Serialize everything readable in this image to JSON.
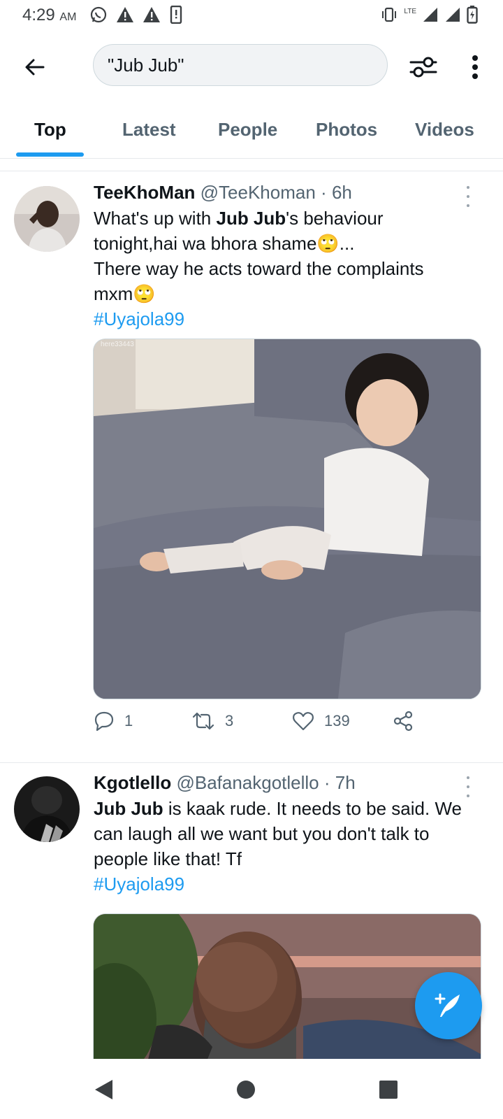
{
  "status_bar": {
    "time": "4:29",
    "ampm": "AM",
    "network_label": "LTE",
    "icons": [
      "whatsapp-icon",
      "warning-icon",
      "warning-icon",
      "phone-alert-icon",
      "vibrate-icon",
      "signal-icon",
      "signal-icon",
      "battery-icon"
    ]
  },
  "search": {
    "query": "\"Jub Jub\""
  },
  "tabs": [
    {
      "label": "Top",
      "active": true
    },
    {
      "label": "Latest",
      "active": false
    },
    {
      "label": "People",
      "active": false
    },
    {
      "label": "Photos",
      "active": false
    },
    {
      "label": "Videos",
      "active": false
    }
  ],
  "tweets": [
    {
      "name": "TeeKhoMan",
      "handle": "@TeeKhoman",
      "time": "6h",
      "text_line1_pre": "What's up with ",
      "text_line1_bold": "Jub Jub",
      "text_line1_post": "'s behaviour",
      "text_line2": "tonight,hai wa bhora shame🙄...",
      "text_line3": "There way he acts toward the complaints",
      "text_line4": "mxm🙄",
      "hashtag": "#Uyajola99",
      "media_watermark": "here33443",
      "replies": "1",
      "retweets": "3",
      "likes": "139"
    },
    {
      "name": "Kgotlello",
      "handle": "@Bafanakgotlello",
      "time": "7h",
      "text_bold": "Jub Jub",
      "text_line1_post": " is kaak rude. It needs to be said. We",
      "text_line2": "can laugh all we want but you don't talk to",
      "text_line3": "people like that! Tf",
      "hashtag": "#Uyajola99"
    }
  ],
  "colors": {
    "accent": "#1d9bf0",
    "text_primary": "#0f1419",
    "text_secondary": "#536471"
  }
}
